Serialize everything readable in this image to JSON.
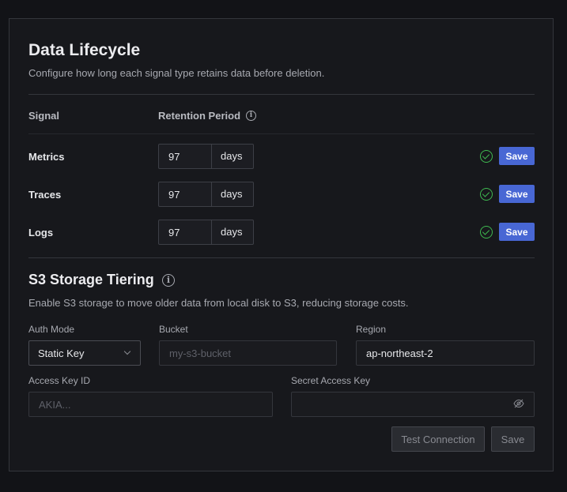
{
  "lifecycle": {
    "title": "Data Lifecycle",
    "subtitle": "Configure how long each signal type retains data before deletion.",
    "col_signal": "Signal",
    "col_retention": "Retention Period",
    "info_icon": "info-icon",
    "save_label": "Save",
    "rows": [
      {
        "label": "Metrics",
        "value": "97",
        "unit": "days",
        "status_icon": "check-circle-icon"
      },
      {
        "label": "Traces",
        "value": "97",
        "unit": "days",
        "status_icon": "check-circle-icon"
      },
      {
        "label": "Logs",
        "value": "97",
        "unit": "days",
        "status_icon": "check-circle-icon"
      }
    ]
  },
  "s3": {
    "title": "S3 Storage Tiering",
    "subtitle": "Enable S3 storage to move older data from local disk to S3, reducing storage costs.",
    "auth_mode_label": "Auth Mode",
    "auth_mode_value": "Static Key",
    "bucket_label": "Bucket",
    "bucket_placeholder": "my-s3-bucket",
    "region_label": "Region",
    "region_value": "ap-northeast-2",
    "access_key_label": "Access Key ID",
    "access_key_placeholder": "AKIA...",
    "secret_key_label": "Secret Access Key",
    "secret_key_value": "",
    "test_connection_label": "Test Connection",
    "save_label": "Save"
  },
  "colors": {
    "accent": "#4867d4",
    "success": "#3fb950",
    "panel_bg": "#17181c",
    "page_bg": "#121317"
  }
}
